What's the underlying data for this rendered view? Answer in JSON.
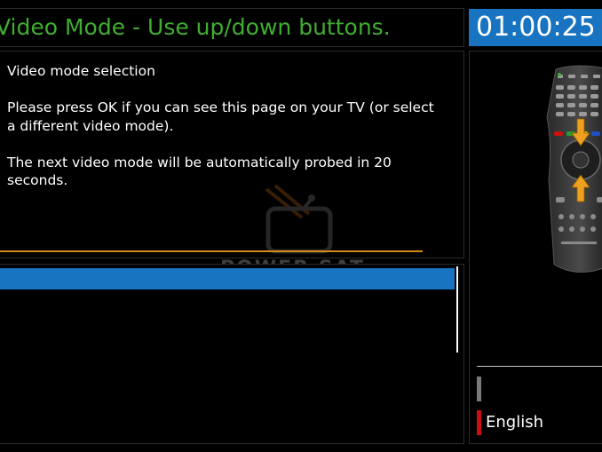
{
  "header": {
    "title": "Video Mode - Use up/down buttons.",
    "clock": "01:00:25"
  },
  "message": {
    "line1": "Video mode selection",
    "line2": "Please press OK if you can see this page on your TV (or select a different video mode).",
    "line3": "The next video mode will be automatically probed in 20 seconds."
  },
  "watermark": {
    "text": "POWER SAT"
  },
  "sidebar": {
    "language": "English"
  },
  "colors": {
    "accent_blue": "#1874c0",
    "title_green": "#3fae2f",
    "progress_orange": "#d88a1a",
    "red_key": "#cc1010"
  },
  "icons": [
    "remote-control-icon",
    "arrow-down-icon",
    "arrow-up-icon",
    "tv-logo-icon"
  ]
}
